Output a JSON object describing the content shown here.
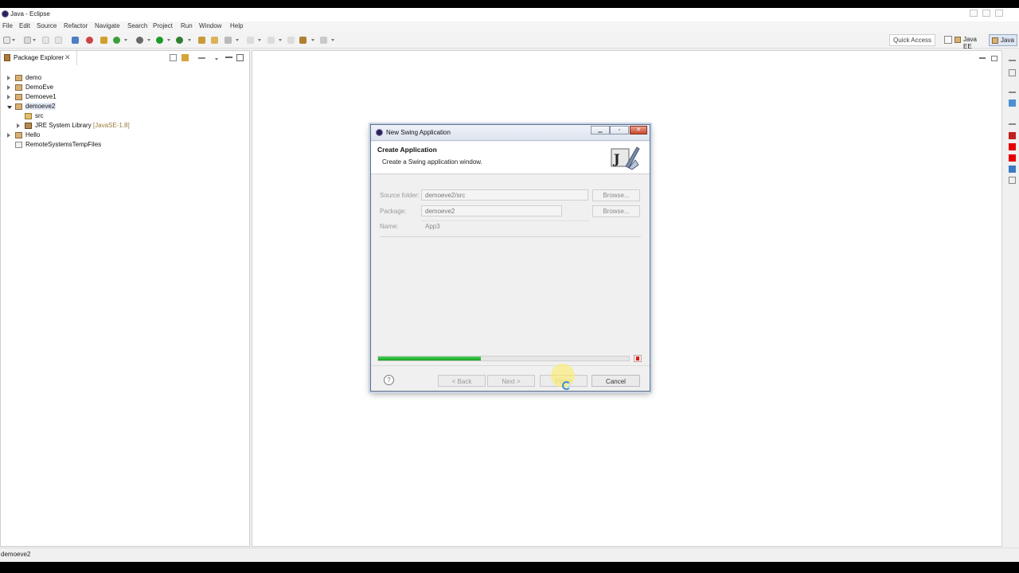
{
  "window": {
    "title": "Java - Eclipse"
  },
  "menu": [
    "File",
    "Edit",
    "Source",
    "Refactor",
    "Navigate",
    "Search",
    "Project",
    "Run",
    "Window",
    "Help"
  ],
  "toolbar": {
    "quick_access": "Quick Access",
    "perspectives": [
      "Java EE",
      "Java"
    ]
  },
  "package_explorer": {
    "tab_label": "Package Explorer",
    "tree": [
      {
        "label": "demo"
      },
      {
        "label": "DemoEve"
      },
      {
        "label": "Demoeve1"
      },
      {
        "label": "demoeve2"
      },
      {
        "label": "src"
      },
      {
        "label": "JRE System Library",
        "suffix": "[JavaSE-1.8]"
      },
      {
        "label": "Hello"
      },
      {
        "label": "RemoteSystemsTempFiles"
      }
    ]
  },
  "status_bar": {
    "text": "demoeve2"
  },
  "dialog": {
    "title": "New Swing Application",
    "heading": "Create Application",
    "message": "Create a Swing application window.",
    "fields": {
      "source_folder": {
        "label": "Source folder:",
        "value": "demoeve2/src"
      },
      "package": {
        "label": "Package:",
        "value": "demoeve2"
      },
      "name": {
        "label": "Name:",
        "value": "App3"
      }
    },
    "browse_label": "Browse...",
    "progress": 0.41,
    "buttons": {
      "help": "?",
      "back": "< Back",
      "next": "Next >",
      "finish": "Finish",
      "cancel": "Cancel"
    }
  },
  "colors": {
    "progress": "#13a322",
    "selection": "#e3e9f6",
    "accent_red": "#e60000"
  }
}
